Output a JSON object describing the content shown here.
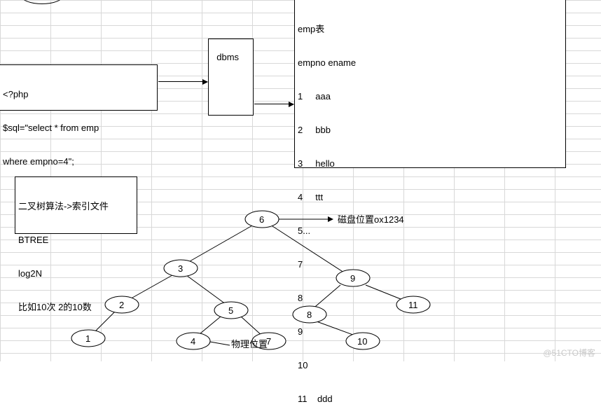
{
  "code_box": {
    "line1": "<?php",
    "line2": "$sql=\"select * from emp",
    "line3": "where empno=4\";"
  },
  "dbms_box": {
    "label": "dbms"
  },
  "table_box": {
    "title": "emp表",
    "header": "empno ename",
    "rows": [
      "1     aaa",
      "2     bbb",
      "3     hello",
      "4     ttt",
      "5...",
      "7",
      "8",
      "9",
      "10",
      "11    ddd"
    ]
  },
  "note_box": {
    "line1": "二叉树算法->索引文件",
    "line2": "BTREE",
    "line3": "log2N",
    "line4": "比如10次 2的10数"
  },
  "tree": {
    "nodes": {
      "n6": "6",
      "n3": "3",
      "n9": "9",
      "n2": "2",
      "n5": "5",
      "n8": "8",
      "n11": "11",
      "n1": "1",
      "n4": "4",
      "n7": "7",
      "n10": "10"
    },
    "caption_right": "磁盘位置ox1234",
    "caption_bottom": "物理位置"
  },
  "watermark": "@51CTO博客"
}
